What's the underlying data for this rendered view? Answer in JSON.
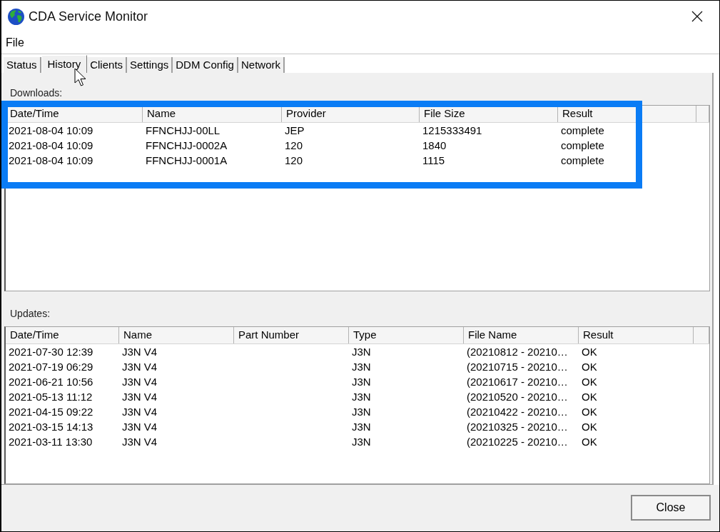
{
  "window": {
    "title": "CDA Service Monitor"
  },
  "menu": [
    "File"
  ],
  "tabs": [
    {
      "label": "Status",
      "selected": false
    },
    {
      "label": "History",
      "selected": true
    },
    {
      "label": "Clients",
      "selected": false
    },
    {
      "label": "Settings",
      "selected": false
    },
    {
      "label": "DDM Config",
      "selected": false
    },
    {
      "label": "Network",
      "selected": false
    }
  ],
  "downloads": {
    "label": "Downloads:",
    "highlighted": true,
    "columns": [
      "Date/Time",
      "Name",
      "Provider",
      "File Size",
      "Result"
    ],
    "rows": [
      {
        "date_time": "2021-08-04 10:09",
        "name": "FFNCHJJ-00LL",
        "provider": "JEP",
        "file_size": "1215333491",
        "result": "complete"
      },
      {
        "date_time": "2021-08-04 10:09",
        "name": "FFNCHJJ-0002A",
        "provider": "120",
        "file_size": "1840",
        "result": "complete"
      },
      {
        "date_time": "2021-08-04 10:09",
        "name": "FFNCHJJ-0001A",
        "provider": "120",
        "file_size": "1115",
        "result": "complete"
      }
    ]
  },
  "updates": {
    "label": "Updates:",
    "columns": [
      "Date/Time",
      "Name",
      "Part Number",
      "Type",
      "File Name",
      "Result"
    ],
    "rows": [
      {
        "date_time": "2021-07-30 12:39",
        "name": "J3N V4",
        "type": "J3N",
        "file_name": "(20210812 - 20210…",
        "result": "OK"
      },
      {
        "date_time": "2021-07-19 06:29",
        "name": "J3N V4",
        "type": "J3N",
        "file_name": "(20210715 - 20210…",
        "result": "OK"
      },
      {
        "date_time": "2021-06-21 10:56",
        "name": "J3N V4",
        "type": "J3N",
        "file_name": "(20210617 - 20210…",
        "result": "OK"
      },
      {
        "date_time": "2021-05-13 11:12",
        "name": "J3N V4",
        "type": "J3N",
        "file_name": "(20210520 - 20210…",
        "result": "OK"
      },
      {
        "date_time": "2021-04-15 09:22",
        "name": "J3N V4",
        "type": "J3N",
        "file_name": "(20210422 - 20210…",
        "result": "OK"
      },
      {
        "date_time": "2021-03-15 14:13",
        "name": "J3N V4",
        "type": "J3N",
        "file_name": "(20210325 - 20210…",
        "result": "OK"
      },
      {
        "date_time": "2021-03-11 13:30",
        "name": "J3N V4",
        "type": "J3N",
        "file_name": "(20210225 - 20210…",
        "result": "OK"
      }
    ]
  },
  "buttons": [
    "Close"
  ]
}
